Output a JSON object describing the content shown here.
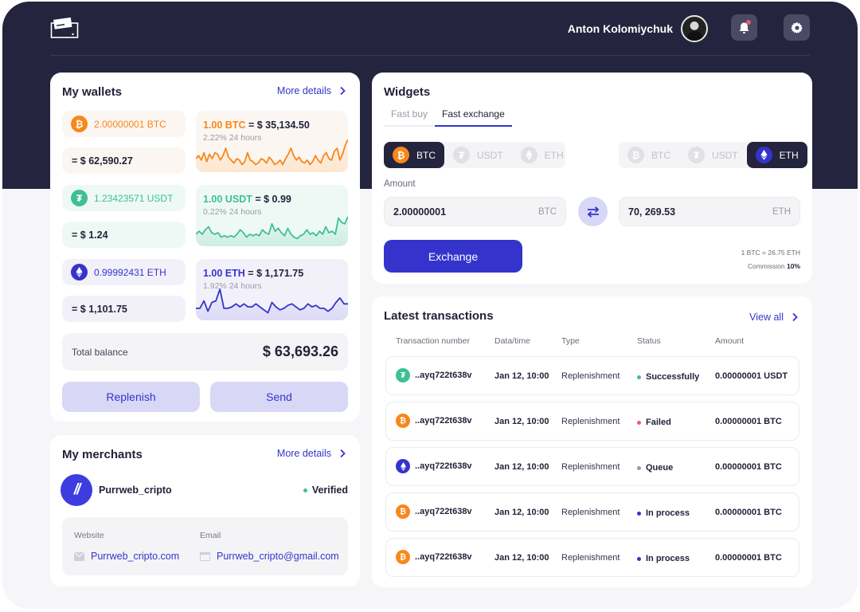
{
  "header": {
    "logo_icon": "wallet-card-icon",
    "user_name": "Anton Kolomiychuk",
    "avatar_icon": "user-avatar",
    "notifications_icon": "bell-icon",
    "has_unread_notifications": true,
    "settings_icon": "gear-icon"
  },
  "colors": {
    "header_bg": "#24243e",
    "accent": "#3434cc",
    "btc": "#f7871c",
    "usdt": "#3fbf96",
    "eth": "#3434cc",
    "status_success": "#3fbf96",
    "status_failed": "#f0557a",
    "status_queue": "#9a9aa8",
    "status_in_process": "#3434cc"
  },
  "wallets": {
    "title": "My wallets",
    "more_label": "More details",
    "items": [
      {
        "coin": "BTC",
        "icon": "bitcoin-icon",
        "balance": "2.00000001 BTC",
        "usd_value": "= $ 62,590.27",
        "rate_coin": "1.00 BTC",
        "rate_value": "= $ 35,134.50",
        "change": "2.22% 24 hours",
        "sparkline": [
          0.35,
          0.45,
          0.3,
          0.55,
          0.25,
          0.5,
          0.35,
          0.55,
          0.5,
          0.3,
          0.45,
          0.7,
          0.4,
          0.3,
          0.2,
          0.35,
          0.3,
          0.15,
          0.25,
          0.55,
          0.3,
          0.25,
          0.15,
          0.2,
          0.35,
          0.3,
          0.2,
          0.4,
          0.3,
          0.15,
          0.2,
          0.3,
          0.15,
          0.35,
          0.5,
          0.7,
          0.45,
          0.3,
          0.4,
          0.25,
          0.2,
          0.3,
          0.15,
          0.25,
          0.45,
          0.3,
          0.2,
          0.45,
          0.55,
          0.35,
          0.3,
          0.6,
          0.7,
          0.3,
          0.5,
          0.8,
          1.0
        ]
      },
      {
        "coin": "USDT",
        "icon": "tether-icon",
        "balance": "1.23423571 USDT",
        "usd_value": "= $ 1.24",
        "rate_coin": "1.00 USDT",
        "rate_value": "= $ 0.99",
        "change": "0.22% 24 hours",
        "sparkline": [
          0.3,
          0.4,
          0.3,
          0.45,
          0.55,
          0.35,
          0.3,
          0.35,
          0.2,
          0.25,
          0.2,
          0.25,
          0.2,
          0.3,
          0.45,
          0.35,
          0.2,
          0.3,
          0.25,
          0.3,
          0.25,
          0.45,
          0.35,
          0.3,
          0.65,
          0.4,
          0.5,
          0.35,
          0.25,
          0.5,
          0.3,
          0.2,
          0.15,
          0.25,
          0.3,
          0.45,
          0.3,
          0.35,
          0.25,
          0.4,
          0.3,
          0.55,
          0.35,
          0.4,
          0.3,
          0.85,
          0.7,
          0.65,
          0.9
        ]
      },
      {
        "coin": "ETH",
        "icon": "ethereum-icon",
        "balance": "0.99992431 ETH",
        "usd_value": "= $ 1,101.75",
        "rate_coin": "1.00 ETH",
        "rate_value": "= $ 1,171.75",
        "change": "1.92% 24 hours",
        "sparkline": [
          0.3,
          0.3,
          0.55,
          0.2,
          0.5,
          0.55,
          0.95,
          0.3,
          0.3,
          0.35,
          0.45,
          0.35,
          0.45,
          0.35,
          0.35,
          0.45,
          0.35,
          0.25,
          0.15,
          0.5,
          0.35,
          0.25,
          0.3,
          0.4,
          0.45,
          0.35,
          0.25,
          0.3,
          0.45,
          0.35,
          0.4,
          0.3,
          0.3,
          0.2,
          0.3,
          0.5,
          0.65,
          0.45,
          0.45
        ]
      }
    ],
    "total_label": "Total balance",
    "total_value": "$ 63,693.26",
    "replenish_label": "Replenish",
    "send_label": "Send"
  },
  "merchants": {
    "title": "My merchants",
    "more_label": "More details",
    "name": "Purrweb_cripto",
    "logo_text": "//",
    "status": "Verified",
    "website_label": "Website",
    "website_icon": "envelope-icon",
    "website_value": "Purrweb_cripto.com",
    "email_label": "Email",
    "email_icon": "browser-window-icon",
    "email_value": "Purrweb_cripto@gmail.com"
  },
  "widgets": {
    "title": "Widgets",
    "tabs": [
      {
        "label": "Fast buy",
        "active": false
      },
      {
        "label": "Fast exchange",
        "active": true
      }
    ],
    "from_options": [
      {
        "label": "BTC",
        "icon": "bitcoin-icon",
        "selected": true
      },
      {
        "label": "USDT",
        "icon": "tether-icon",
        "selected": false
      },
      {
        "label": "ETH",
        "icon": "ethereum-icon",
        "selected": false
      }
    ],
    "to_options": [
      {
        "label": "BTC",
        "icon": "bitcoin-icon",
        "selected": false
      },
      {
        "label": "USDT",
        "icon": "tether-icon",
        "selected": false
      },
      {
        "label": "ETH",
        "icon": "ethereum-icon",
        "selected": true
      }
    ],
    "amount_label": "Amount",
    "from_amount": "2.00000001",
    "from_unit": "BTC",
    "to_amount": "70, 269.53",
    "to_unit": "ETH",
    "swap_icon": "swap-arrows-icon",
    "exchange_label": "Exchange",
    "rate_text": "1 BTC =  26.75 ETH",
    "commission_label": "Commission",
    "commission_value": "10%"
  },
  "transactions": {
    "title": "Latest transactions",
    "view_all_label": "View all",
    "columns": [
      "Transaction number",
      "Data/time",
      "Type",
      "Status",
      "Amount"
    ],
    "rows": [
      {
        "coin": "USDT",
        "icon": "tether-icon",
        "number": "..ayq722t638v",
        "datetime": "Jan 12, 10:00",
        "type": "Replenishment",
        "status": "Successfully",
        "status_kind": "success",
        "amount": "0.00000001 USDT"
      },
      {
        "coin": "BTC",
        "icon": "bitcoin-icon",
        "number": "..ayq722t638v",
        "datetime": "Jan 12, 10:00",
        "type": "Replenishment",
        "status": "Failed",
        "status_kind": "failed",
        "amount": "0.00000001 BTC"
      },
      {
        "coin": "ETH",
        "icon": "ethereum-icon",
        "number": "..ayq722t638v",
        "datetime": "Jan 12, 10:00",
        "type": "Replenishment",
        "status": "Queue",
        "status_kind": "queue",
        "amount": "0.00000001 BTC"
      },
      {
        "coin": "BTC",
        "icon": "bitcoin-icon",
        "number": "..ayq722t638v",
        "datetime": "Jan 12, 10:00",
        "type": "Replenishment",
        "status": "In process",
        "status_kind": "in_process",
        "amount": "0.00000001 BTC"
      },
      {
        "coin": "BTC",
        "icon": "bitcoin-icon",
        "number": "..ayq722t638v",
        "datetime": "Jan 12, 10:00",
        "type": "Replenishment",
        "status": "In process",
        "status_kind": "in_process",
        "amount": "0.00000001 BTC"
      }
    ]
  }
}
